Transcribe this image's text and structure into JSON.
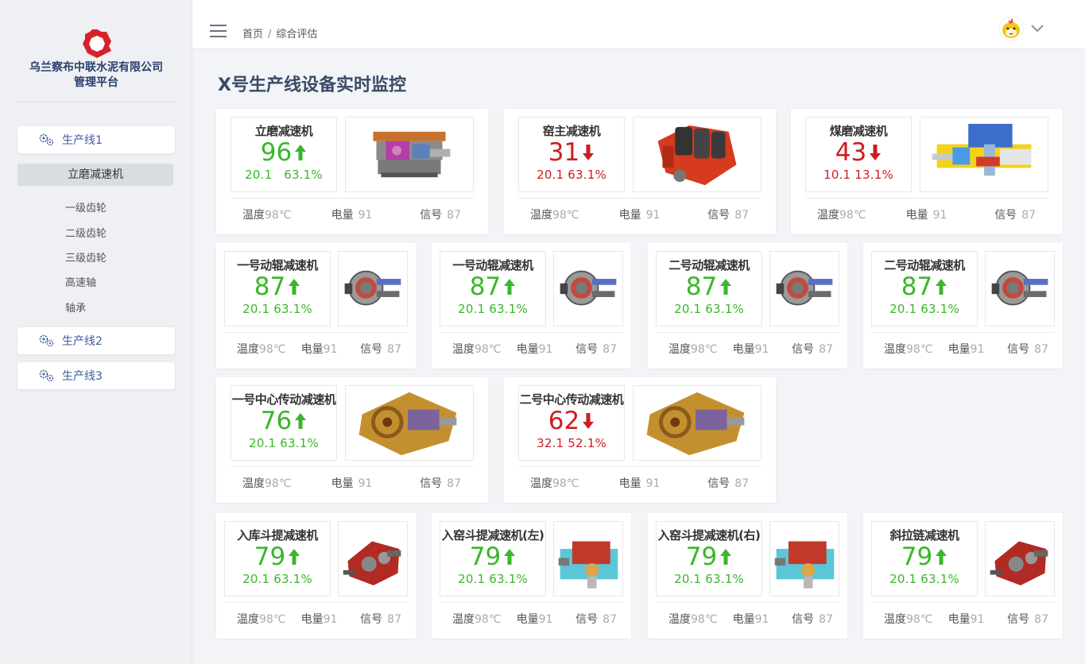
{
  "sidebar": {
    "company_line1": "乌兰察布中联水泥有限公司",
    "company_line2": "管理平台",
    "lines": [
      {
        "label": "生产线1"
      },
      {
        "label": "生产线2"
      },
      {
        "label": "生产线3"
      }
    ],
    "active_item": "立磨减速机",
    "sub_items": [
      "一级齿轮",
      "二级齿轮",
      "三级齿轮",
      "高速轴",
      "轴承"
    ]
  },
  "header": {
    "breadcrumb_home": "首页",
    "breadcrumb_sep": "/",
    "breadcrumb_current": "综合评估"
  },
  "page_title": "X号生产线设备实时监控",
  "stat_labels": {
    "temp": "温度",
    "power": "电量",
    "signal": "信号"
  },
  "cards": [
    {
      "name": "立磨减速机",
      "value": "96",
      "trend": "up",
      "sub": "20.1   63.1%",
      "temp": "98℃",
      "power": "91",
      "signal": "87",
      "image": "vertical-mill-gearbox"
    },
    {
      "name": "窑主减速机",
      "value": "31",
      "trend": "down",
      "sub": "20.1 63.1%",
      "temp": "98℃",
      "power": "91",
      "signal": "87",
      "image": "kiln-gearbox"
    },
    {
      "name": "煤磨减速机",
      "value": "43",
      "trend": "down",
      "sub": "10.1 13.1%",
      "temp": "98℃",
      "power": "91",
      "signal": "87",
      "image": "coal-mill-diagram"
    },
    {
      "name": "一号动辊减速机",
      "value": "87",
      "trend": "up",
      "sub": "20.1 63.1%",
      "temp": "98℃",
      "power": "91",
      "signal": "87",
      "image": "roller-gearbox"
    },
    {
      "name": "一号动辊减速机",
      "value": "87",
      "trend": "up",
      "sub": "20.1 63.1%",
      "temp": "98℃",
      "power": "91",
      "signal": "87",
      "image": "roller-gearbox"
    },
    {
      "name": "二号动辊减速机",
      "value": "87",
      "trend": "up",
      "sub": "20.1 63.1%",
      "temp": "98℃",
      "power": "91",
      "signal": "87",
      "image": "roller-gearbox"
    },
    {
      "name": "二号动辊减速机",
      "value": "87",
      "trend": "up",
      "sub": "20.1 63.1%",
      "temp": "98℃",
      "power": "91",
      "signal": "87",
      "image": "roller-gearbox"
    },
    {
      "name": "一号中心传动减速机",
      "value": "76",
      "trend": "up",
      "sub": "20.1 63.1%",
      "temp": "98℃",
      "power": "91",
      "signal": "87",
      "image": "center-drive-gearbox"
    },
    {
      "name": "二号中心传动减速机",
      "value": "62",
      "trend": "down",
      "sub": "32.1 52.1%",
      "temp": "98℃",
      "power": "91",
      "signal": "87",
      "image": "center-drive-gearbox"
    },
    {
      "name": "入库斗提减速机",
      "value": "79",
      "trend": "up",
      "sub": "20.1 63.1%",
      "temp": "98℃",
      "power": "91",
      "signal": "87",
      "image": "red-gearbox"
    },
    {
      "name": "入窑斗提减速机(左)",
      "value": "79",
      "trend": "up",
      "sub": "20.1 63.1%",
      "temp": "98℃",
      "power": "91",
      "signal": "87",
      "image": "blue-gearbox"
    },
    {
      "name": "入窑斗提减速机(右)",
      "value": "79",
      "trend": "up",
      "sub": "20.1 63.1%",
      "temp": "98℃",
      "power": "91",
      "signal": "87",
      "image": "blue-gearbox"
    },
    {
      "name": "斜拉链减速机",
      "value": "79",
      "trend": "up",
      "sub": "20.1 63.1%",
      "temp": "98℃",
      "power": "91",
      "signal": "87",
      "image": "red-gearbox"
    }
  ],
  "colors": {
    "up": "#3ab72a",
    "down": "#cc1e22",
    "accent": "#3d5b9a",
    "logo": "#d7202a"
  }
}
